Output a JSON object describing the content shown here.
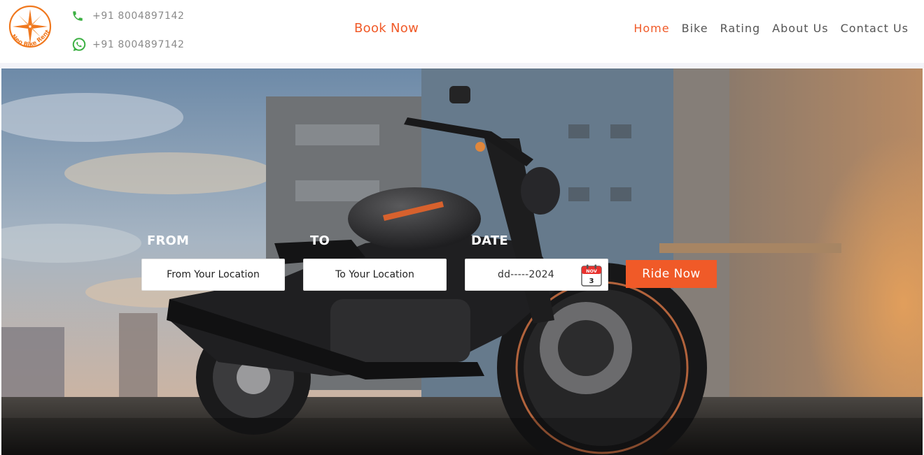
{
  "brand": {
    "logo_text": "Neo Bike Rental",
    "accent": "#f05a28"
  },
  "contacts": [
    {
      "icon": "phone-icon",
      "text": "+91 8004897142"
    },
    {
      "icon": "whatsapp-icon",
      "text": "+91 8004897142"
    }
  ],
  "header": {
    "book_now": "Book Now"
  },
  "nav": {
    "items": [
      {
        "label": "Home",
        "active": true
      },
      {
        "label": "Bike",
        "active": false
      },
      {
        "label": "Rating",
        "active": false
      },
      {
        "label": "About Us",
        "active": false
      },
      {
        "label": "Contact Us",
        "active": false
      }
    ]
  },
  "search_form": {
    "from_label": "FROM",
    "to_label": "TO",
    "date_label": "DATE",
    "from_placeholder": "From Your Location",
    "to_placeholder": "To Your Location",
    "date_value": "dd-----2024",
    "calendar_month": "NOV",
    "calendar_day": "3",
    "submit_label": "Ride Now"
  }
}
